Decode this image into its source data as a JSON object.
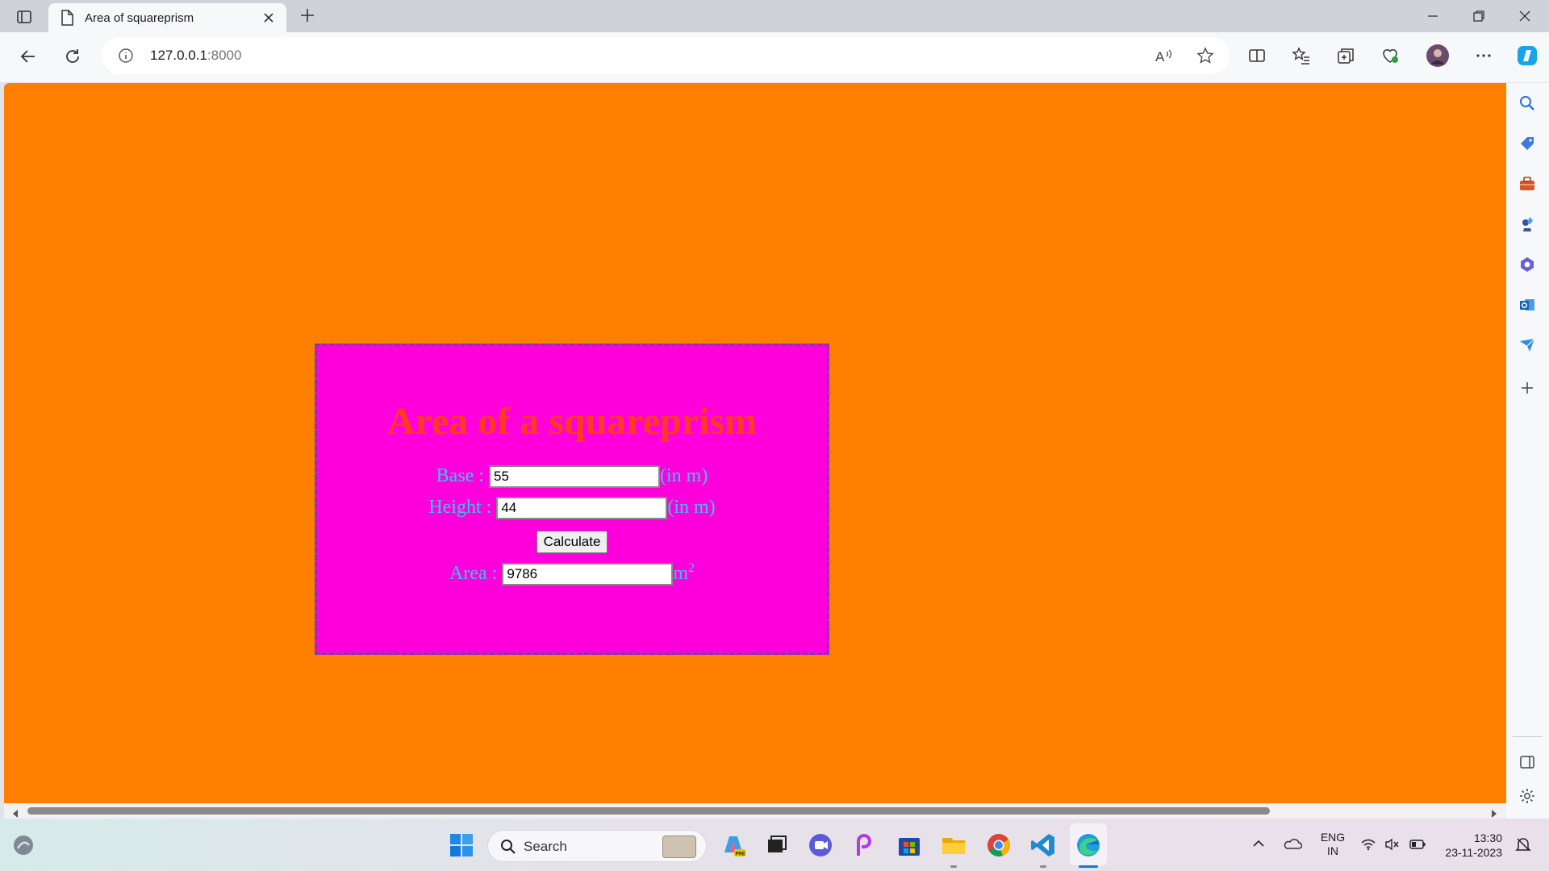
{
  "browser": {
    "tab_title": "Area of squareprism",
    "url_host": "127.0.0.1",
    "url_port": ":8000"
  },
  "page": {
    "background_color": "#ff8000",
    "card_color": "#ff00dd",
    "heading": "Area of a squareprism",
    "base_label": "Base :",
    "base_value": "55",
    "base_unit": "(in m)",
    "height_label": "Height :",
    "height_value": "44",
    "height_unit": "(in m)",
    "calculate_label": "Calculate",
    "area_label": "Area :",
    "area_value": "9786",
    "area_unit": "m",
    "area_unit_exp": "2"
  },
  "taskbar": {
    "search_text": "Search",
    "lang_top": "ENG",
    "lang_bottom": "IN",
    "time": "13:30",
    "date": "23-11-2023"
  }
}
